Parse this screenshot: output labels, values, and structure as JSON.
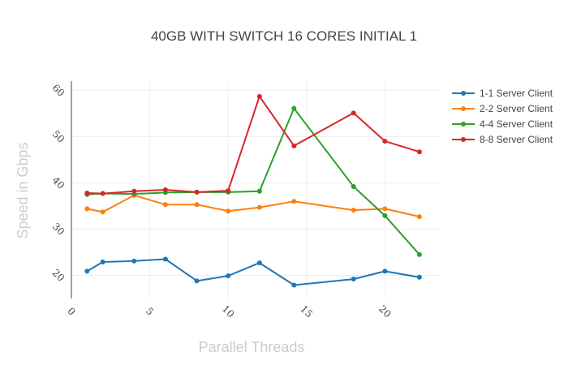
{
  "chart_data": {
    "type": "line",
    "title": "40GB WITH SWITCH 16 CORES INITIAL 1",
    "xlabel": "Parallel Threads",
    "ylabel": "Speed in Gbps",
    "xlim": [
      0,
      23.5
    ],
    "ylim": [
      15,
      62
    ],
    "xticks": [
      0,
      5,
      10,
      15,
      20
    ],
    "yticks": [
      20,
      30,
      40,
      50,
      60
    ],
    "grid": true,
    "legend_position": "top-right",
    "series": [
      {
        "name": "1-1 Server Client",
        "color": "#1f77b4",
        "x": [
          1,
          2,
          4,
          6,
          8,
          10,
          12,
          14.2,
          18,
          20,
          22.2
        ],
        "y": [
          20.9,
          22.9,
          23.1,
          23.5,
          18.8,
          19.9,
          22.7,
          17.9,
          19.2,
          20.9,
          19.6
        ]
      },
      {
        "name": "2-2 Server Client",
        "color": "#ff7f0e",
        "x": [
          1,
          2,
          4,
          6,
          8,
          10,
          12,
          14.2,
          18,
          20,
          22.2
        ],
        "y": [
          34.4,
          33.7,
          37.3,
          35.3,
          35.3,
          33.9,
          34.7,
          36.0,
          34.1,
          34.4,
          32.7
        ]
      },
      {
        "name": "4-4 Server Client",
        "color": "#2ca02c",
        "x": [
          1,
          2,
          4,
          6,
          8,
          10,
          12,
          14.2,
          18,
          20,
          22.2
        ],
        "y": [
          37.5,
          37.7,
          37.6,
          37.9,
          38.0,
          38.0,
          38.2,
          56.1,
          39.2,
          32.9,
          24.5
        ]
      },
      {
        "name": "8-8 Server Client",
        "color": "#d62728",
        "x": [
          1,
          2,
          4,
          6,
          8,
          10,
          12,
          14.2,
          18,
          20,
          22.2
        ],
        "y": [
          37.8,
          37.7,
          38.2,
          38.5,
          38.0,
          38.3,
          58.7,
          48.0,
          55.1,
          49.0,
          46.7
        ]
      }
    ]
  }
}
